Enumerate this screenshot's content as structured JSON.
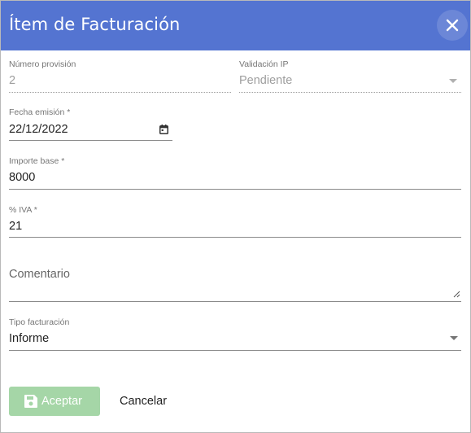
{
  "dialog": {
    "title": "Ítem de Facturación",
    "close_icon": "close-icon"
  },
  "form": {
    "numero_provision": {
      "label": "Número provisión",
      "value": "2"
    },
    "validacion_ip": {
      "label": "Validación IP",
      "value": "Pendiente",
      "icon": "chevron-down-icon"
    },
    "fecha_emision": {
      "label": "Fecha emisión *",
      "value": "22/12/2022",
      "icon": "calendar-icon"
    },
    "importe_base": {
      "label": "Importe base *",
      "value": "8000"
    },
    "iva": {
      "label": "% IVA *",
      "value": "21"
    },
    "comentario": {
      "label": "Comentario",
      "value": "",
      "icon": "resize-handle-icon"
    },
    "tipo_facturacion": {
      "label": "Tipo facturación",
      "value": "Informe",
      "icon": "chevron-down-icon"
    }
  },
  "actions": {
    "accept_label": "Aceptar",
    "accept_icon": "save-icon",
    "cancel_label": "Cancelar"
  },
  "colors": {
    "header": "#5474d1",
    "accept_button": "#a5d6a7",
    "text": "#222222",
    "label": "#757575"
  }
}
